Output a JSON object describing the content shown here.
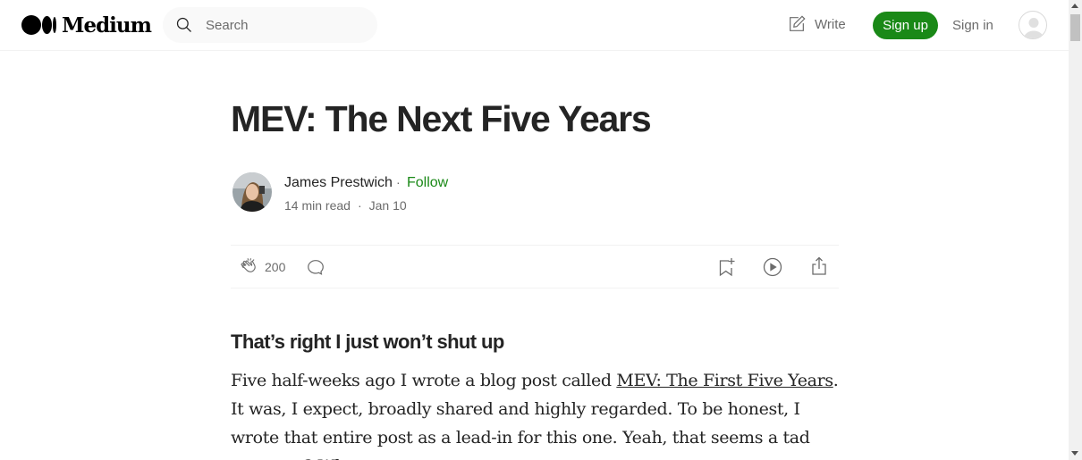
{
  "header": {
    "logo_text": "Medium",
    "search_placeholder": "Search",
    "write_label": "Write",
    "signup_label": "Sign up",
    "signin_label": "Sign in"
  },
  "article": {
    "title": "MEV: The Next Five Years",
    "author": "James Prestwich",
    "follow_label": "Follow",
    "separator": "·",
    "read_time": "14 min read",
    "date": "Jan 10",
    "clap_count": "200",
    "subtitle": "That’s right I just won’t shut up",
    "body_before_link": "Five half-weeks ago I wrote a blog post called ",
    "body_link": "MEV: The First Five Years",
    "body_after_link": ". It was, I expect, broadly shared and highly regarded. To be honest, I wrote that entire post as a lead-in for this one. Yeah, that seems a tad crazy, no? Who"
  },
  "colors": {
    "accent_green": "#1a8917",
    "text_primary": "#242424",
    "text_secondary": "#6b6b6b"
  },
  "icons": [
    "medium-logo-icon",
    "search-icon",
    "write-icon",
    "user-avatar-icon",
    "clap-icon",
    "comment-icon",
    "bookmark-icon",
    "play-icon",
    "share-icon"
  ]
}
